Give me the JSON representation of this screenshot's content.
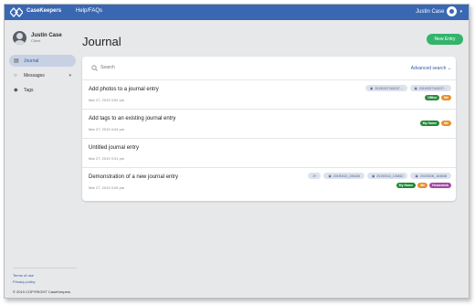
{
  "colors": {
    "header": "#3a67b2",
    "accent_green": "#32b46b",
    "tag_office": "#2e8b3e",
    "tag_me": "#e8902e",
    "tag_my_home": "#1f8a34",
    "tag_homework": "#a349a4"
  },
  "header": {
    "brand": "CaseKeepers",
    "help": "Help/FAQs",
    "user_name": "Justin Case"
  },
  "profile": {
    "name": "Justin Case",
    "role": "Client"
  },
  "sidebar": {
    "items": [
      {
        "label": "Journal",
        "icon": "book-icon"
      },
      {
        "label": "Messages",
        "icon": "chat-icon"
      },
      {
        "label": "Tags",
        "icon": "tag-icon"
      }
    ],
    "footer": {
      "terms": "Terms of use",
      "privacy": "Privacy policy",
      "copyright": "© 2019 COPYRIGHT CaseKeepers"
    }
  },
  "main": {
    "title": "Journal",
    "new_entry": "New Entry",
    "search_placeholder": "Search",
    "advanced_search": "Advanced search"
  },
  "entries": [
    {
      "title": "Add photos to a journal entry",
      "date": "Mar 27, 2019 3:52 pm",
      "attachments": [
        "20190327163237...",
        "20190327163237..."
      ],
      "tags": [
        {
          "label": "Office",
          "color": "#2e8b3e"
        },
        {
          "label": "Me",
          "color": "#e8902e"
        }
      ]
    },
    {
      "title": "Add tags to an existing journal entry",
      "date": "Mar 27, 2019 4:04 pm",
      "attachments": [],
      "tags": [
        {
          "label": "My Home",
          "color": "#1f8a34"
        },
        {
          "label": "Me",
          "color": "#e8902e"
        }
      ]
    },
    {
      "title": "Untitled journal entry",
      "date": "Mar 27, 2019 3:31 pm",
      "attachments": [],
      "tags": []
    },
    {
      "title": "Demonstration of a new journal entry",
      "date": "Mar 27, 2019 3:05 pm",
      "attachments": [
        "3+",
        "20190313_105426",
        "20190313_130810",
        "20190206_163848"
      ],
      "tags": [
        {
          "label": "My Home",
          "color": "#1f8a34"
        },
        {
          "label": "Me",
          "color": "#e8902e"
        },
        {
          "label": "Homework",
          "color": "#a349a4"
        }
      ]
    }
  ]
}
